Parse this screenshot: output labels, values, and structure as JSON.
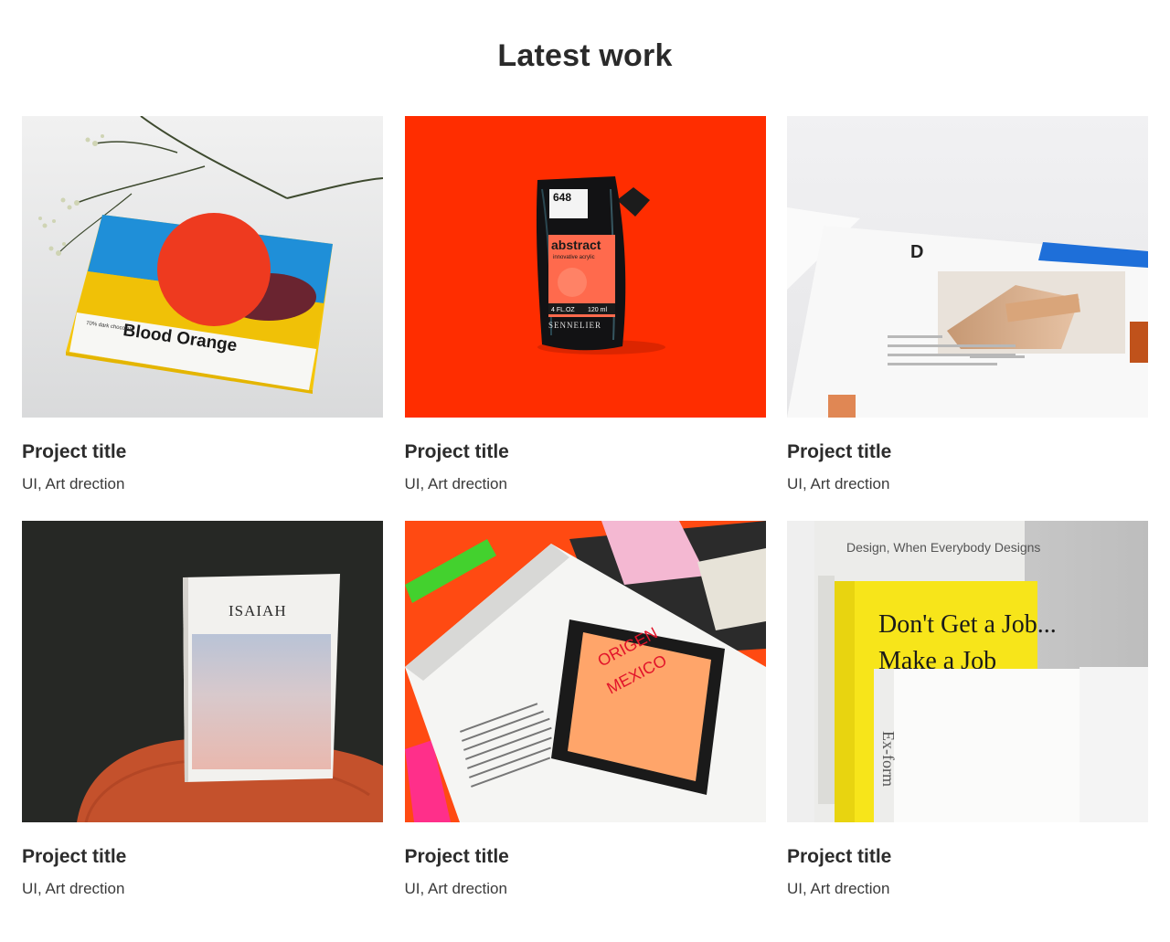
{
  "section": {
    "title": "Latest work"
  },
  "projects": [
    {
      "title": "Project title",
      "tags": "UI, Art drection",
      "image": "blood-orange-chocolate-package",
      "image_text": [
        "Blood Orange",
        "70% dark chocolate"
      ]
    },
    {
      "title": "Project title",
      "tags": "UI, Art drection",
      "image": "abstract-acrylic-paint-pouch",
      "image_text": [
        "648",
        "abstract",
        "innovative acrylic",
        "4 FL.OZ",
        "120 ml",
        "SENNELIER"
      ]
    },
    {
      "title": "Project title",
      "tags": "UI, Art drection",
      "image": "printed-page-closeup",
      "image_text": [
        "D"
      ]
    },
    {
      "title": "Project title",
      "tags": "UI, Art drection",
      "image": "isaiah-book-on-stool",
      "image_text": [
        "ISAIAH"
      ]
    },
    {
      "title": "Project title",
      "tags": "UI, Art drection",
      "image": "open-magazine-with-highlighters",
      "image_text": [
        "ORIGEN",
        "MEXICO"
      ]
    },
    {
      "title": "Project title",
      "tags": "UI, Art drection",
      "image": "design-books-on-shelf",
      "image_text": [
        "Design, When Everybody Designs",
        "Don't Get a Job...",
        "Make a Job",
        "Ex-form"
      ]
    }
  ],
  "colors": {
    "background": "#ffffff",
    "text": "#2b2b2b",
    "accent_orange": "#ff2d00"
  }
}
